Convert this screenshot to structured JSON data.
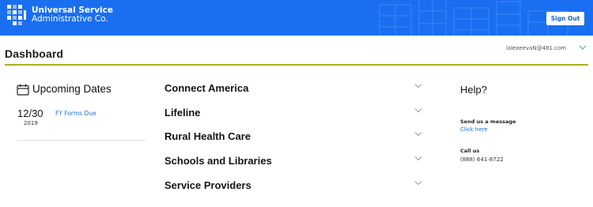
{
  "header": {
    "brand_line1": "Universal Service",
    "brand_line2": "Administrative Co.",
    "signout_label": "Sign Out",
    "banner_color": "#1a6ff0"
  },
  "dashboard": {
    "title": "Dashboard",
    "user_email": "lalexeevaN@481.com",
    "accent_rule_color": "#a9b21c"
  },
  "upcoming": {
    "title": "Upcoming Dates",
    "icon": "calendar-icon",
    "items": [
      {
        "day": "12/30",
        "year": "2019",
        "label": "FY Forms Due"
      }
    ]
  },
  "programs": [
    {
      "label": "Connect America"
    },
    {
      "label": "Lifeline"
    },
    {
      "label": "Rural Health Care"
    },
    {
      "label": "Schools and Libraries"
    },
    {
      "label": "Service Providers"
    }
  ],
  "help": {
    "title": "Help?",
    "message_heading": "Send us a message",
    "message_link": "Click here",
    "call_heading": "Call us",
    "phone": "(888) 641-8722",
    "link_color": "#1a6fd1"
  }
}
